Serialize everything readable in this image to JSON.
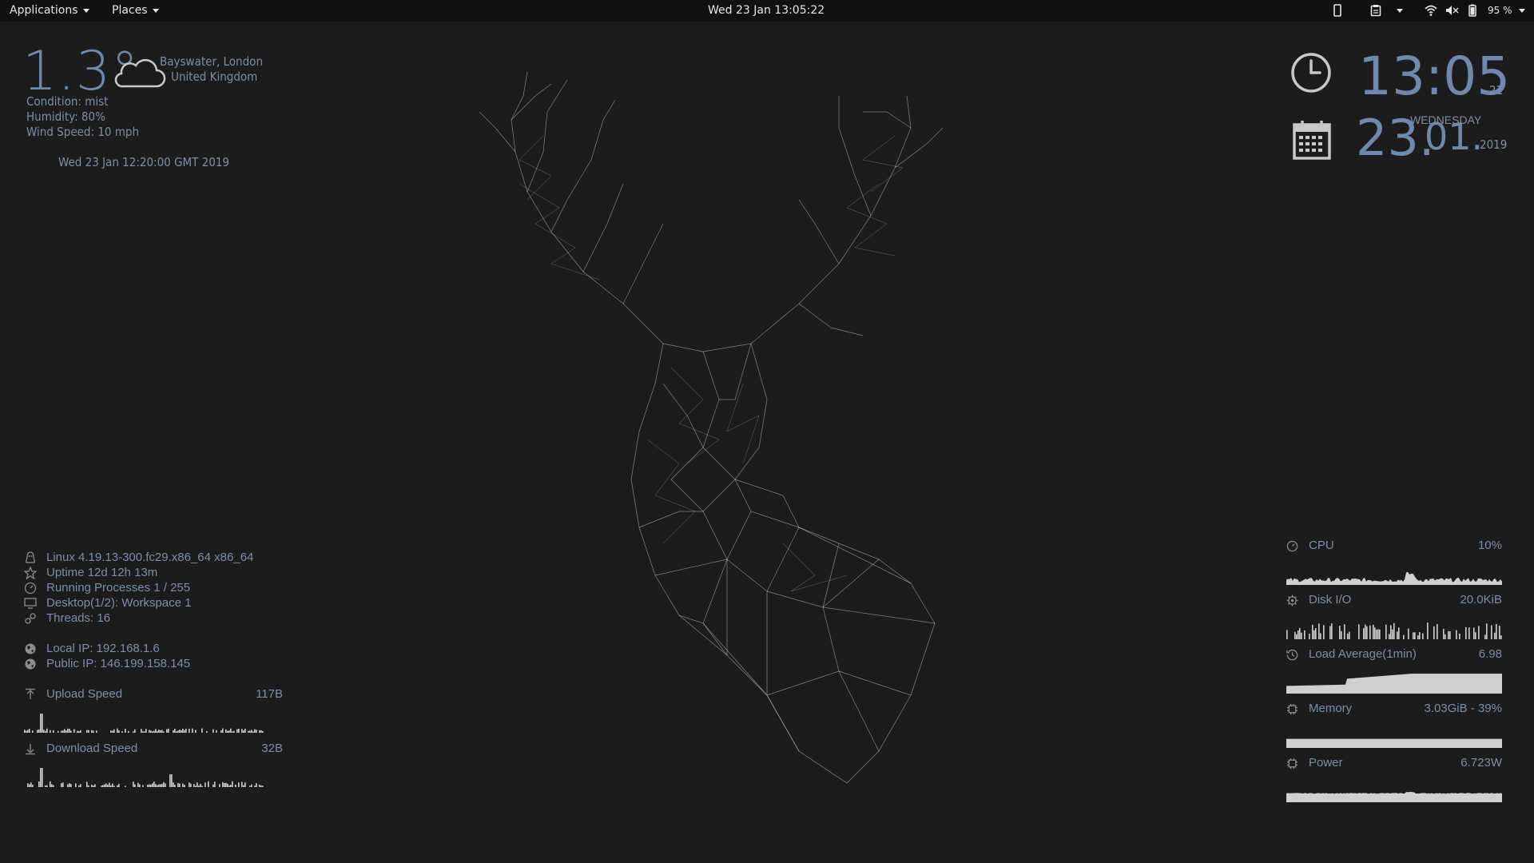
{
  "topbar": {
    "applications": "Applications",
    "places": "Places",
    "clock": "Wed 23 Jan  13:05:22",
    "battery_pct": "95 %"
  },
  "weather": {
    "temperature": "1.3°",
    "location_line1": "Bayswater, London",
    "location_line2": "United Kingdom",
    "condition": "Condition: mist",
    "humidity": "Humidity: 80%",
    "wind": "Wind Speed: 10 mph",
    "updated": "Wed 23 Jan 12:20:00 GMT 2019"
  },
  "clock_widget": {
    "time": "13:05",
    "seconds": "21",
    "day": "23.",
    "month": "01.",
    "weekday": "WEDNESDAY",
    "year": "2019"
  },
  "system": {
    "kernel": "Linux 4.19.13-300.fc29.x86_64 x86_64",
    "uptime": "Uptime 12d 12h 13m",
    "processes": "Running Processes 1 / 255",
    "desktop": "Desktop(1/2): Workspace 1",
    "threads": "Threads: 16",
    "local_ip": "Local IP: 192.168.1.6",
    "public_ip": "Public IP: 146.199.158.145",
    "upload_label": "Upload Speed",
    "upload_value": "117B",
    "download_label": "Download Speed",
    "download_value": "32B"
  },
  "monitors": {
    "cpu_label": "CPU",
    "cpu_value": "10%",
    "disk_label": "Disk I/O",
    "disk_value": "20.0KiB",
    "load_label": "Load Average(1min)",
    "load_value": "6.98",
    "memory_label": "Memory",
    "memory_value": "3.03GiB - 39%",
    "power_label": "Power",
    "power_value": "6.723W"
  },
  "colors": {
    "background": "#1c1c1c",
    "topbar": "#111111",
    "accent_text": "#6f88ad",
    "dim_text": "#7e8ea6",
    "graph": "#cfcfcf"
  }
}
